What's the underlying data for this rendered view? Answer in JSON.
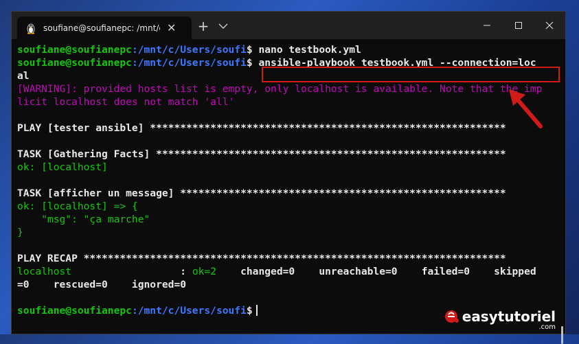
{
  "window": {
    "tab_title": "soufiane@soufianepc: /mnt/c/U",
    "tab_close": "✕",
    "new_tab": "+"
  },
  "terminal": {
    "user": "soufiane@soufianepc",
    "path": ":/mnt/c/Users/soufi",
    "prompt": "$",
    "cmd1": " nano testbook.yml",
    "cmd2": " ansible-playbook testbook.yml --connection=loc",
    "cmd2_wrap": "al",
    "warning1": "[WARNING]: provided hosts list is empty, only localhost is available. Note that the imp",
    "warning2": "licit localhost does not match 'all'",
    "play": "PLAY [tester ansible] ***********************************************************",
    "task1": "TASK [Gathering Facts] **********************************************************",
    "ok1": "ok: [localhost]",
    "task2": "TASK [afficher un message] ******************************************************",
    "ok2": "ok: [localhost] => {",
    "msg": "    \"msg\": \"ça marche\"",
    "close_brace": "}",
    "recap": "PLAY RECAP **********************************************************************",
    "recap_host": "localhost",
    "recap_pad": "                  : ",
    "recap_ok": "ok=2",
    "recap_rest": "    changed=0    unreachable=0    failed=0    skipped",
    "recap_line2": "=0    rescued=0    ignored=0"
  },
  "watermark": {
    "brand": "easytutoriel",
    "suffix": ".com"
  },
  "colors": {
    "highlight": "#d11b1b",
    "green": "#16c60c",
    "blue": "#3b78ff",
    "magenta": "#c00ab8"
  }
}
